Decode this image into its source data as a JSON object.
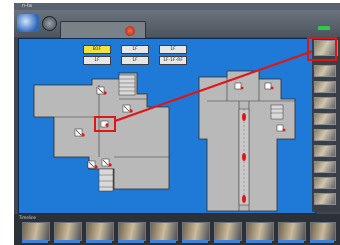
{
  "window": {
    "title": "n-ta"
  },
  "status_panel": {
    "left_label": "",
    "right_label": ""
  },
  "floor_buttons": {
    "row1": [
      "B1F",
      "1F",
      "1F"
    ],
    "row2": [
      "1F",
      "1F",
      "1F-1F-RF"
    ],
    "active_index": 0
  },
  "map": {
    "room_label_1": "",
    "room_label_2": ""
  },
  "bottom_panel": {
    "label": "Timeline"
  },
  "colors": {
    "accent": "#1e7ad6",
    "highlight": "#e01515",
    "active_floor": "#f2e23a"
  }
}
